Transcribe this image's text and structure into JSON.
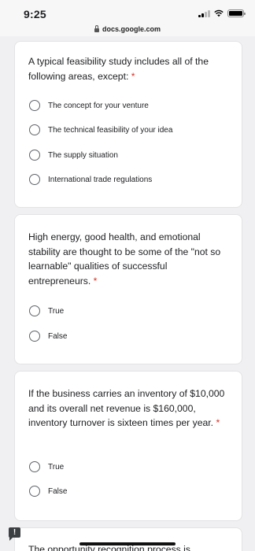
{
  "status_bar": {
    "time": "9:25",
    "url": "docs.google.com"
  },
  "questions": [
    {
      "title": "A typical feasibility study includes all of the following areas, except:",
      "required_mark": "*",
      "options": [
        "The concept for your venture",
        "The technical feasibility of your idea",
        "The supply situation",
        "International trade regulations"
      ]
    },
    {
      "title": "High energy, good health, and emotional stability are thought to be some of the \"not so learnable\" qualities of successful entrepreneurs.",
      "required_mark": "*",
      "options": [
        "True",
        "False"
      ]
    },
    {
      "title": "If the business carries an inventory of $10,000 and its overall net revenue is $160,000, inventory turnover is sixteen times per year.",
      "required_mark": "*",
      "options": [
        "True",
        "False"
      ]
    },
    {
      "title": "The opportunity recognition process is"
    }
  ],
  "report_badge": "!",
  "colors": {
    "background": "#f0f0f3",
    "required": "#d93025",
    "radio_border": "#5f6368"
  }
}
